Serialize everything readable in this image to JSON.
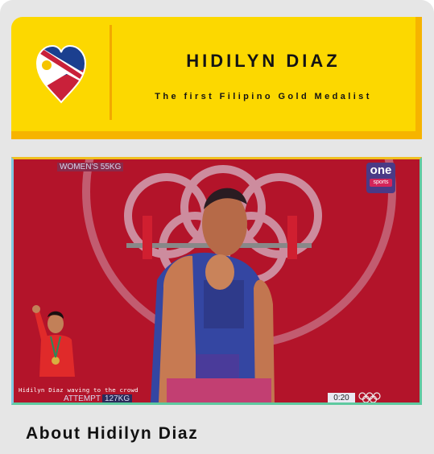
{
  "header": {
    "logo_icon": "philippine-flag-heart-icon",
    "title": "HIDILYN DIAZ",
    "subtitle": "The first Filipino Gold Medalist"
  },
  "hero": {
    "image_icon": "weightlifter-photo",
    "broadcast_overlay": {
      "event": "WOMEN'S 55KG",
      "attempt": "ATTEMPT",
      "weight": "127KG",
      "timer": "0:20",
      "channel_top": "one",
      "channel_bottom": "sports"
    },
    "inset_caption": "Hidilyn Diaz waving to the crowd"
  },
  "about": {
    "heading": "About Hidilyn Diaz"
  },
  "colors": {
    "header_bg": "#fcd800",
    "header_edge": "#f6b400",
    "page_bg": "#e6e6e6",
    "hero_bg": "#b6152a"
  }
}
